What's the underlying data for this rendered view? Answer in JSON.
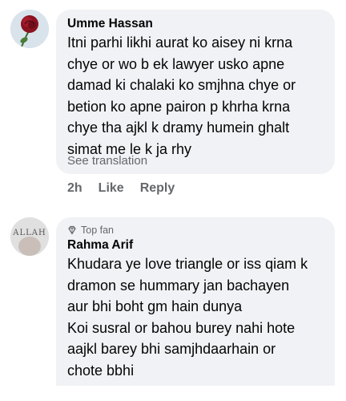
{
  "comments": [
    {
      "author": "Umme Hassan",
      "text": "Itni parhi likhi aurat ko aisey ni krna\nchye or wo b ek lawyer usko apne\ndamad ki chalaki ko smjhna chye or\nbetion ko apne pairon p khrha krna\nchye tha ajkl k dramy humein ghalt\nsimat me le k ja rhy",
      "see_translation": "See translation",
      "time": "2h",
      "like_label": "Like",
      "reply_label": "Reply",
      "avatar_icon": "rose-avatar-icon"
    },
    {
      "badge": "Top fan",
      "badge_icon": "diamond-badge-icon",
      "author": "Rahma Arif",
      "text": "Khudara ye love triangle or iss qiam k\ndramon se hummary jan bachayen\naur bhi boht gm hain dunya\nKoi susral or bahou burey nahi hote\naajkl barey bhi samjhdaarhain or\nchote bbhi",
      "avatar_text": "ALLAH",
      "avatar_icon": "hands-avatar-icon"
    }
  ],
  "colors": {
    "bubble": "#f0f2f5",
    "text": "#050505",
    "secondary": "#65676b"
  }
}
